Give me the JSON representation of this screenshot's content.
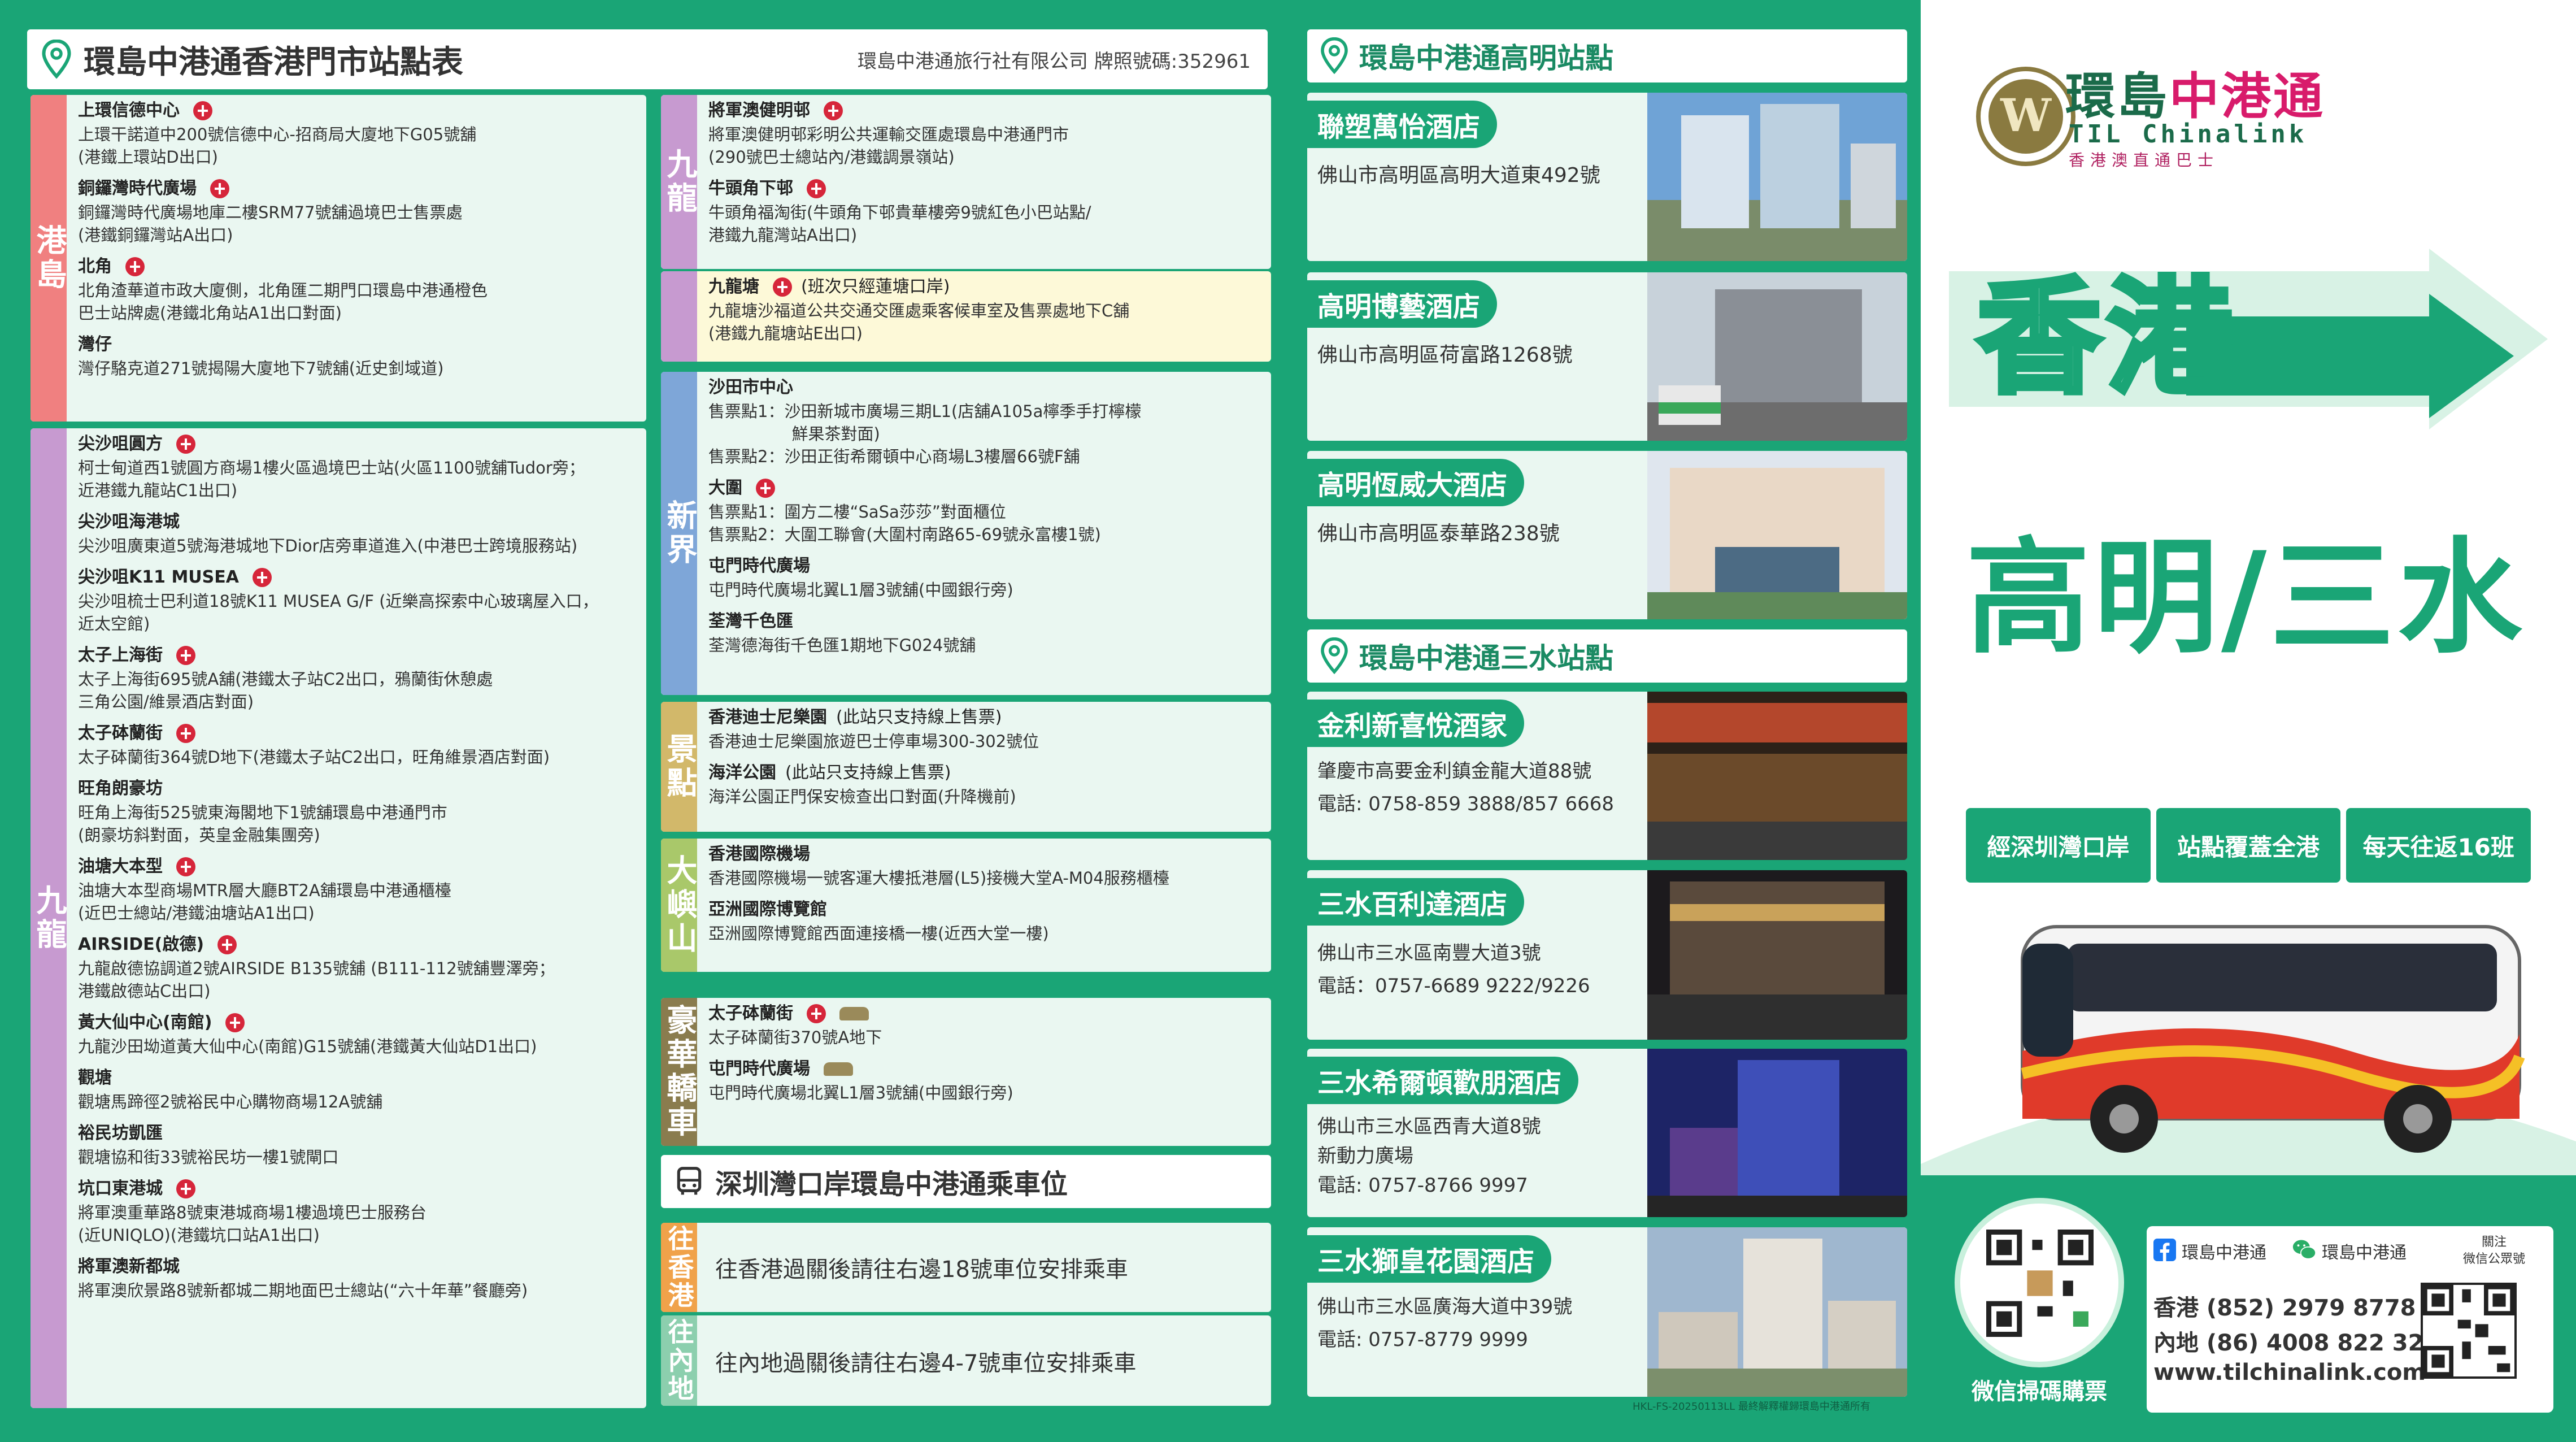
{
  "hk_header": {
    "title": "環島中港通香港門市站點表",
    "company": "環島中港通旅行社有限公司  牌照號碼:352961"
  },
  "groups": [
    {
      "key": "hk_island",
      "label": "港島",
      "color": "#f08080",
      "stops": [
        {
          "name": "上環信德中心",
          "mtr": true,
          "lines": [
            "上環干諾道中200號信德中心-招商局大廈地下G05號舖",
            "(港鐵上環站D出口)"
          ]
        },
        {
          "name": "銅鑼灣時代廣場",
          "mtr": true,
          "lines": [
            "銅鑼灣時代廣場地庫二樓SRM77號舖過境巴士售票處",
            "(港鐵銅鑼灣站A出口)"
          ]
        },
        {
          "name": "北角",
          "mtr": true,
          "lines": [
            "北角渣華道市政大廈側，北角匯二期門口環島中港通橙色",
            "巴士站牌處(港鐵北角站A1出口對面)"
          ]
        },
        {
          "name": "灣仔",
          "mtr": false,
          "lines": [
            "灣仔駱克道271號揭陽大廈地下7號舖(近史釗域道)"
          ]
        }
      ]
    },
    {
      "key": "kowloon",
      "label": "九龍",
      "color": "#c79ad0",
      "stops": [
        {
          "name": "尖沙咀圓方",
          "mtr": true,
          "lines": [
            "柯士甸道西1號圓方商場1樓火區過境巴士站(火區1100號舖Tudor旁；",
            "近港鐵九龍站C1出口)"
          ]
        },
        {
          "name": "尖沙咀海港城",
          "mtr": false,
          "lines": [
            "尖沙咀廣東道5號海港城地下Dior店旁車道進入(中港巴士跨境服務站)"
          ]
        },
        {
          "name": "尖沙咀K11 MUSEA",
          "mtr": true,
          "lines": [
            "尖沙咀梳士巴利道18號K11 MUSEA G/F (近樂高探索中心玻璃屋入口，",
            "近太空館)"
          ]
        },
        {
          "name": "太子上海街",
          "mtr": true,
          "lines": [
            "太子上海街695號A舖(港鐵太子站C2出口，鴉蘭街休憩處",
            "三角公園/維景酒店對面)"
          ]
        },
        {
          "name": "太子砵蘭街",
          "mtr": true,
          "lines": [
            "太子砵蘭街364號D地下(港鐵太子站C2出口，旺角維景酒店對面)"
          ]
        },
        {
          "name": "旺角朗豪坊",
          "mtr": false,
          "lines": [
            "旺角上海街525號東海閣地下1號舖環島中港通門市",
            "(朗豪坊斜對面，英皇金融集團旁)"
          ]
        },
        {
          "name": "油塘大本型",
          "mtr": true,
          "lines": [
            "油塘大本型商場MTR層大廳BT2A舖環島中港通櫃檯",
            "(近巴士總站/港鐵油塘站A1出口)"
          ]
        },
        {
          "name": "AIRSIDE(啟德)",
          "mtr": true,
          "lines": [
            "九龍啟德協調道2號AIRSIDE B135號舖 (B111-112號舖豐澤旁；",
            "港鐵啟德站C出口)"
          ]
        },
        {
          "name": "黃大仙中心(南館)",
          "mtr": true,
          "lines": [
            "九龍沙田坳道黃大仙中心(南館)G15號舖(港鐵黃大仙站D1出口)"
          ]
        },
        {
          "name": "觀塘",
          "mtr": false,
          "lines": [
            "觀塘馬蹄徑2號裕民中心購物商場12A號舖"
          ]
        },
        {
          "name": "裕民坊凱匯",
          "mtr": false,
          "lines": [
            "觀塘協和街33號裕民坊一樓1號閘口"
          ]
        },
        {
          "name": "坑口東港城",
          "mtr": true,
          "lines": [
            "將軍澳重華路8號東港城商場1樓過境巴士服務台",
            "(近UNIQLO)(港鐵坑口站A1出口)"
          ]
        },
        {
          "name": "將軍澳新都城",
          "mtr": false,
          "lines": [
            "將軍澳欣景路8號新都城二期地面巴士總站(“六十年華”餐廳旁)"
          ]
        }
      ]
    },
    {
      "key": "kowloon2",
      "label": "九龍",
      "color": "#c79ad0",
      "stops": [
        {
          "name": "將軍澳健明邨",
          "mtr": true,
          "lines": [
            "將軍澳健明邨彩明公共運輸交匯處環島中港通門市",
            "(290號巴士總站內/港鐵調景嶺站)"
          ]
        },
        {
          "name": "牛頭角下邨",
          "mtr": true,
          "lines": [
            "牛頭角福淘街(牛頭角下邨貴華樓旁9號紅色小巴站點/",
            "港鐵九龍灣站A出口)"
          ]
        }
      ]
    },
    {
      "key": "kowloontong",
      "label": "",
      "color": "#c79ad0",
      "stops": [
        {
          "name": "九龍塘",
          "mtr": true,
          "note": "(班次只經蓮塘口岸)",
          "lines": [
            "九龍塘沙福道公共交通交匯處乘客候車室及售票處地下C舖",
            "(港鐵九龍塘站E出口)"
          ]
        }
      ]
    },
    {
      "key": "nt",
      "label": "新界",
      "color": "#7ea6d8",
      "stops": [
        {
          "name": "沙田市中心",
          "mtr": false,
          "lines": [
            "售票點1：沙田新城市廣場三期L1(店舖A105a檸季手打檸檬",
            "                鮮果茶對面)",
            "售票點2：沙田正街希爾頓中心商場L3樓層66號F舖"
          ]
        },
        {
          "name": "大圍",
          "mtr": true,
          "lines": [
            "售票點1：圍方二樓“SaSa莎莎”對面櫃位",
            "售票點2：大圍工聯會(大圍村南路65-69號永富樓1號)"
          ]
        },
        {
          "name": "屯門時代廣場",
          "mtr": false,
          "lines": [
            "屯門時代廣場北翼L1層3號舖(中國銀行旁)"
          ]
        },
        {
          "name": "荃灣千色匯",
          "mtr": false,
          "lines": [
            "荃灣德海街千色匯1期地下G024號舖"
          ]
        }
      ]
    },
    {
      "key": "scenic",
      "label": "景點",
      "color": "#d2b86a",
      "stops": [
        {
          "name": "香港迪士尼樂園",
          "mtr": false,
          "note": "(此站只支持線上售票)",
          "lines": [
            "香港迪士尼樂園旅遊巴士停車場300-302號位"
          ]
        },
        {
          "name": "海洋公園",
          "mtr": false,
          "note": "(此站只支持線上售票)",
          "lines": [
            "海洋公園正門保安檢查出口對面(升降機前)"
          ]
        }
      ]
    },
    {
      "key": "lantau",
      "label": "大嶼山",
      "color": "#a9c86a",
      "stops": [
        {
          "name": "香港國際機場",
          "mtr": false,
          "lines": [
            "香港國際機場一號客運大樓抵港層(L5)接機大堂A-M04服務櫃檯"
          ]
        },
        {
          "name": "亞洲國際博覽館",
          "mtr": false,
          "lines": [
            "亞洲國際博覽館西面連接橋一樓(近西大堂一樓)"
          ]
        }
      ]
    },
    {
      "key": "luxury",
      "label": "豪華轎車",
      "color": "#8a7c4e",
      "stops": [
        {
          "name": "太子砵蘭街",
          "mtr": true,
          "car": true,
          "lines": [
            "太子砵蘭街370號A地下"
          ]
        },
        {
          "name": "屯門時代廣場",
          "mtr": false,
          "car": true,
          "lines": [
            "屯門時代廣場北翼L1層3號舖(中國銀行旁)"
          ]
        }
      ]
    }
  ],
  "shenzhen": {
    "title": "深圳灣口岸環島中港通乘車位",
    "to_hk_label": "往香港",
    "to_hk_text": "往香港過關後請往右邊18號車位安排乘車",
    "to_cn_label": "往內地",
    "to_cn_text": "往內地過關後請往右邊4-7號車位安排乘車"
  },
  "gaoming": {
    "title": "環島中港通高明站點",
    "hotels": [
      {
        "name": "聯塑萬怡酒店",
        "address": "佛山市高明區高明大道東492號"
      },
      {
        "name": "高明博藝酒店",
        "address": "佛山市高明區荷富路1268號"
      },
      {
        "name": "高明恆威大酒店",
        "address": "佛山市高明區泰華路238號"
      }
    ]
  },
  "sanshui": {
    "title": "環島中港通三水站點",
    "hotels": [
      {
        "name": "金利新喜悅酒家",
        "address": "肇慶市高要金利鎮金龍大道88號\n電話: 0758-859 3888/857 6668"
      },
      {
        "name": "三水百利達酒店",
        "address": "佛山市三水區南豐大道3號\n電話：0757-6689 9222/9226"
      },
      {
        "name": "三水希爾頓歡朋酒店",
        "address": "佛山市三水區西青大道8號\n新動力廣場\n電話: 0757-8766 9997"
      },
      {
        "name": "三水獅皇花園酒店",
        "address": "佛山市三水區廣海大道中39號\n電話: 0757-8779 9999"
      }
    ]
  },
  "right": {
    "brand_a": "環島",
    "brand_b": "中港通",
    "brand_en": "TIL Chinalink",
    "brand_sub": "香港澳直通巴士",
    "dest1": "香港",
    "dest2": "高明/三水",
    "features": [
      "經深圳灣口岸",
      "站點覆蓋全港",
      "每天往返16班"
    ],
    "qr_label": "微信掃碼購票",
    "fb_label": "環島中港通",
    "wechat_label": "環島中港通",
    "follow_label": "關注\n微信公眾號",
    "phone_hk": "香港  (852) 2979 8778",
    "phone_cn": "內地  (86) 4008 822 322",
    "website": "www.tilchinalink.com"
  },
  "footer_code": "HKL-FS-20250113LL  最終解釋權歸環島中港通所有"
}
